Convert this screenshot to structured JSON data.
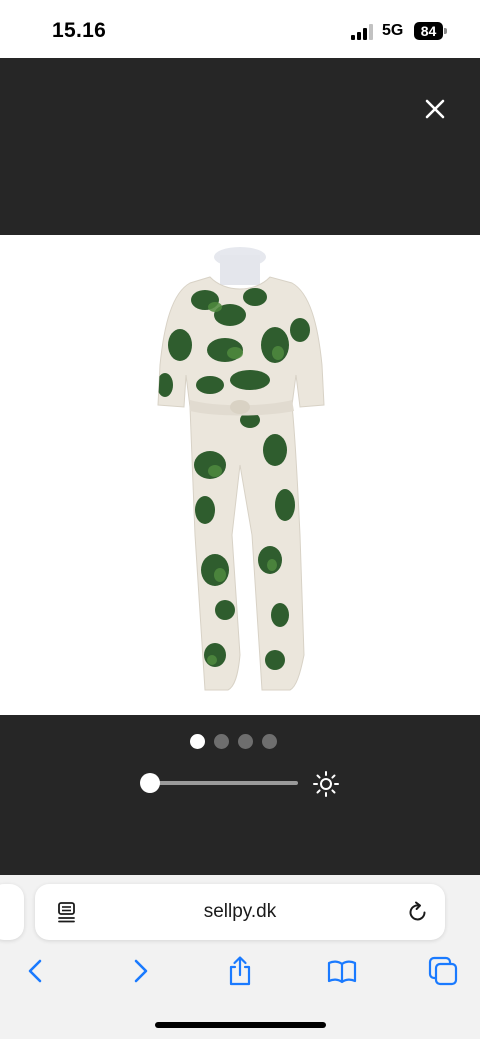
{
  "status_bar": {
    "time": "15.16",
    "network": "5G",
    "battery": "84",
    "signal_icon": "cellular-signal-icon"
  },
  "viewer": {
    "close_icon": "close-icon",
    "image_alt": "Floral jumpsuit on mannequin",
    "pagination": {
      "count": 4,
      "active_index": 0
    },
    "brightness": {
      "level": 0.0,
      "icon": "sun-icon"
    },
    "colors": {
      "background": "#262626",
      "active_dot": "#ffffff",
      "inactive_dot": "#6e6e6e"
    }
  },
  "browser": {
    "url": "sellpy.dk",
    "page_menu_icon": "page-menu-icon",
    "reload_icon": "reload-icon",
    "toolbar": [
      "back-icon",
      "forward-icon",
      "share-icon",
      "bookmarks-icon",
      "tabs-icon"
    ],
    "accent_color": "#1a7aff"
  }
}
